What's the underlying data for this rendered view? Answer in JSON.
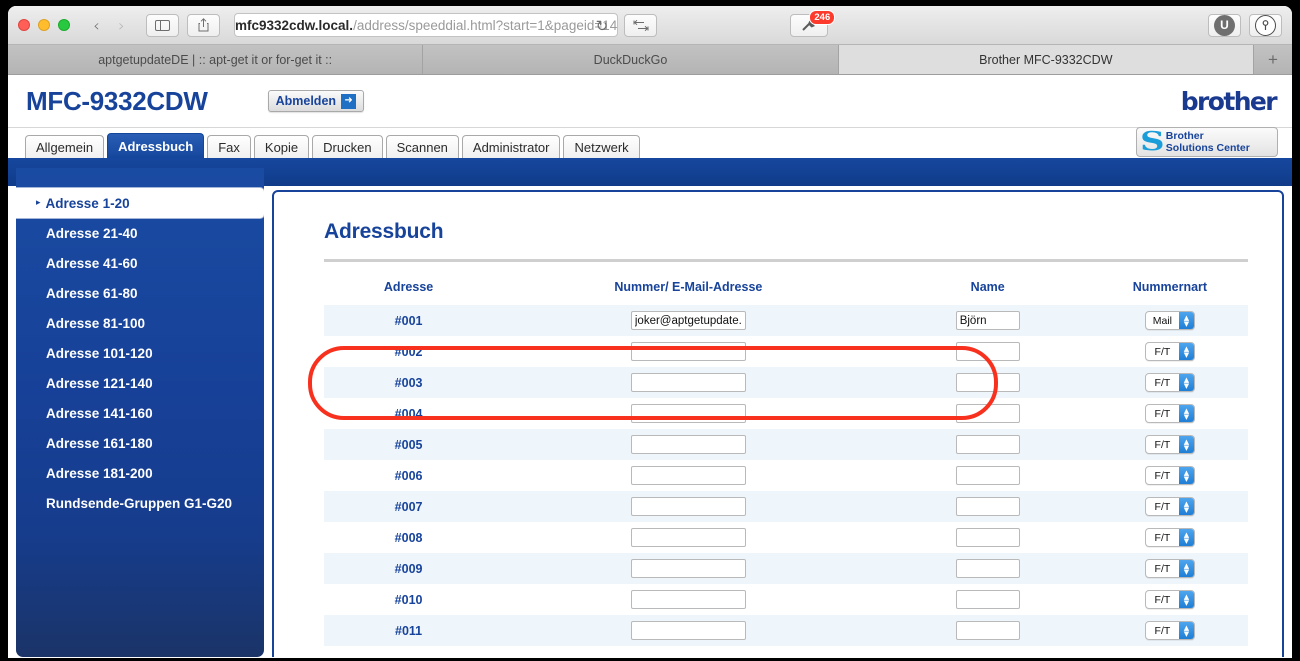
{
  "browser": {
    "traffic_lights": [
      "close",
      "minimize",
      "zoom"
    ],
    "back_label": "‹",
    "forward_label": "›",
    "url_host": "mfc9332cdw.local.",
    "url_path": "/address/speeddial.html?start=1&pageid=14",
    "reload_label": "↻",
    "blocker_badge": "246",
    "ublock_label": "U",
    "onepassword_label": "ⓘ",
    "tabs": [
      {
        "label": "aptgetupdateDE | :: apt-get it or for-get it ::",
        "active": false
      },
      {
        "label": "DuckDuckGo",
        "active": false
      },
      {
        "label": "Brother MFC-9332CDW",
        "active": true
      }
    ],
    "new_tab_label": "+"
  },
  "header": {
    "model": "MFC-9332CDW",
    "logout_label": "Abmelden",
    "logout_arrow": "➜",
    "brand": "brother",
    "solutions_center_line1": "Brother",
    "solutions_center_line2": "Solutions Center",
    "solutions_center_mark": "S"
  },
  "main_tabs": [
    {
      "label": "Allgemein",
      "active": false
    },
    {
      "label": "Adressbuch",
      "active": true
    },
    {
      "label": "Fax",
      "active": false
    },
    {
      "label": "Kopie",
      "active": false
    },
    {
      "label": "Drucken",
      "active": false
    },
    {
      "label": "Scannen",
      "active": false
    },
    {
      "label": "Administrator",
      "active": false
    },
    {
      "label": "Netzwerk",
      "active": false
    }
  ],
  "sidebar": {
    "selected_marker": "▸",
    "items": [
      {
        "label": "Adresse 1-20",
        "selected": true
      },
      {
        "label": "Adresse 21-40",
        "selected": false
      },
      {
        "label": "Adresse 41-60",
        "selected": false
      },
      {
        "label": "Adresse 61-80",
        "selected": false
      },
      {
        "label": "Adresse 81-100",
        "selected": false
      },
      {
        "label": "Adresse 101-120",
        "selected": false
      },
      {
        "label": "Adresse 121-140",
        "selected": false
      },
      {
        "label": "Adresse 141-160",
        "selected": false
      },
      {
        "label": "Adresse 161-180",
        "selected": false
      },
      {
        "label": "Adresse 181-200",
        "selected": false
      },
      {
        "label": "Rundsende-Gruppen G1-G20",
        "selected": false
      }
    ]
  },
  "content": {
    "title": "Adressbuch",
    "columns": {
      "address": "Adresse",
      "number": "Nummer/ E-Mail-Adresse",
      "name": "Name",
      "type": "Nummernart"
    },
    "stepper_up": "▲",
    "stepper_down": "▼",
    "rows": [
      {
        "id": "#001",
        "number": "joker@aptgetupdate.de",
        "name": "Björn",
        "type": "Mail"
      },
      {
        "id": "#002",
        "number": "",
        "name": "",
        "type": "F/T"
      },
      {
        "id": "#003",
        "number": "",
        "name": "",
        "type": "F/T"
      },
      {
        "id": "#004",
        "number": "",
        "name": "",
        "type": "F/T"
      },
      {
        "id": "#005",
        "number": "",
        "name": "",
        "type": "F/T"
      },
      {
        "id": "#006",
        "number": "",
        "name": "",
        "type": "F/T"
      },
      {
        "id": "#007",
        "number": "",
        "name": "",
        "type": "F/T"
      },
      {
        "id": "#008",
        "number": "",
        "name": "",
        "type": "F/T"
      },
      {
        "id": "#009",
        "number": "",
        "name": "",
        "type": "F/T"
      },
      {
        "id": "#010",
        "number": "",
        "name": "",
        "type": "F/T"
      },
      {
        "id": "#011",
        "number": "",
        "name": "",
        "type": "F/T"
      }
    ]
  },
  "annotation": {
    "highlight_color": "#f8311e",
    "shape": "rounded-rectangle"
  },
  "colors": {
    "brand_blue": "#17439b",
    "accent_blue": "#1f7fd6",
    "row_alt": "#eff6fb",
    "highlight_red": "#f8311e"
  }
}
